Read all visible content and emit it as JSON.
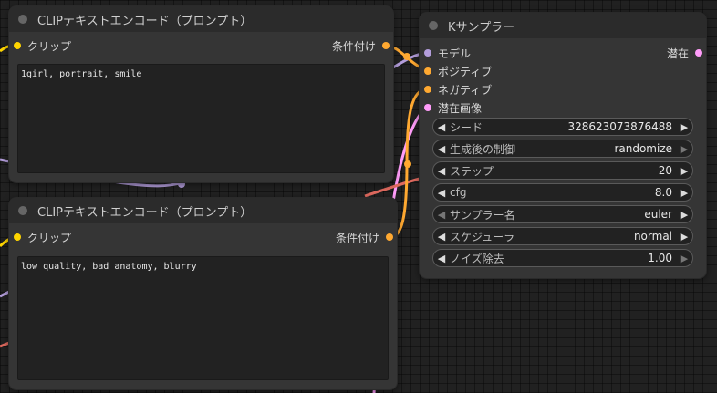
{
  "colors": {
    "clip": "#ffd500",
    "conditioning": "#ffa931",
    "model": "#b39ddb",
    "latent": "#ff9cf9",
    "vae_wire": "#e06a5f"
  },
  "clip_node_1": {
    "title": "CLIPテキストエンコード（プロンプト）",
    "input_label": "クリップ",
    "output_label": "条件付け",
    "text": "1girl, portrait, smile"
  },
  "clip_node_2": {
    "title": "CLIPテキストエンコード（プロンプト）",
    "input_label": "クリップ",
    "output_label": "条件付け",
    "text": "low quality, bad anatomy, blurry"
  },
  "ksampler": {
    "title": "Kサンプラー",
    "inputs": [
      "モデル",
      "ポジティブ",
      "ネガティブ",
      "潜在画像"
    ],
    "output_label": "潜在",
    "widgets": [
      {
        "label": "シード",
        "value": "328623073876488"
      },
      {
        "label": "生成後の制御",
        "value": "randomize"
      },
      {
        "label": "ステップ",
        "value": "20"
      },
      {
        "label": "cfg",
        "value": "8.0"
      },
      {
        "label": "サンプラー名",
        "value": "euler"
      },
      {
        "label": "スケジューラ",
        "value": "normal"
      },
      {
        "label": "ノイズ除去",
        "value": "1.00"
      }
    ]
  },
  "icons": {
    "decrement": "◀",
    "increment": "▶"
  }
}
